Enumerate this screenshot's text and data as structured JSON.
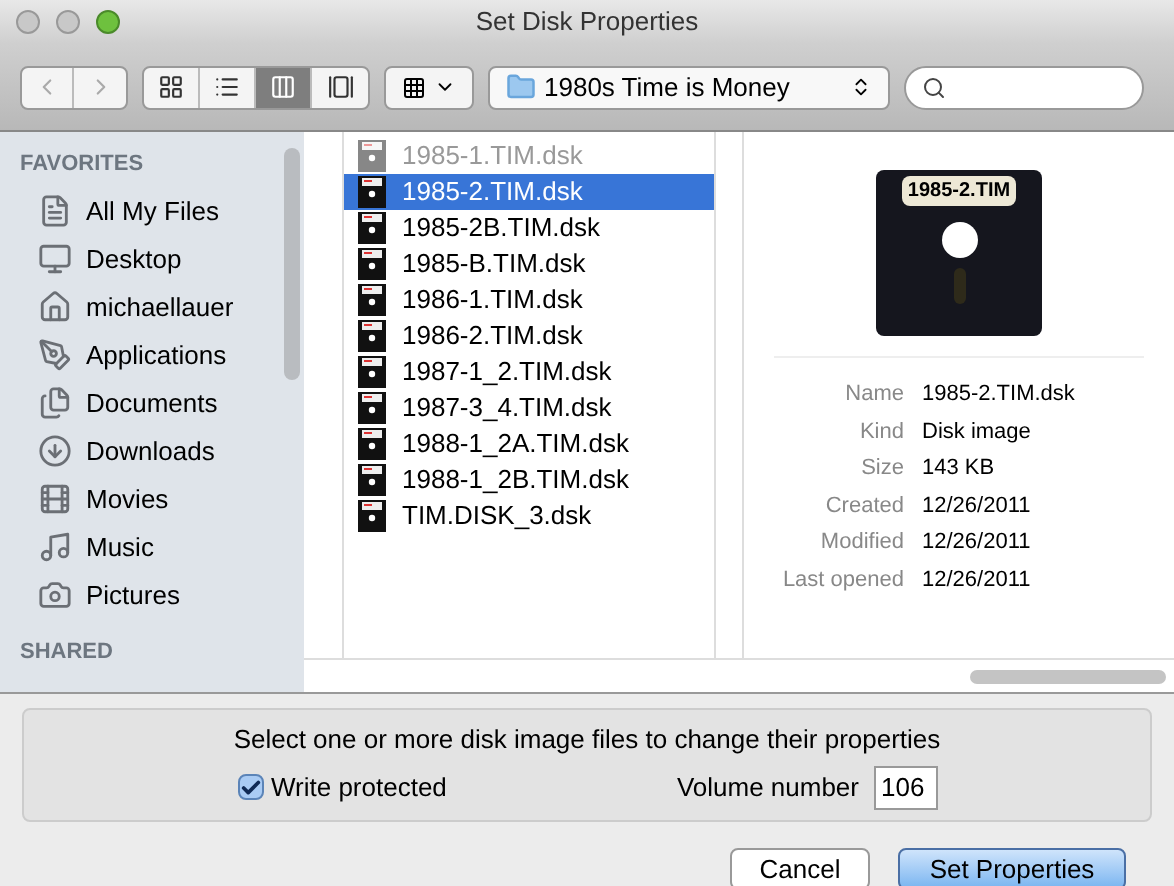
{
  "window": {
    "title": "Set Disk Properties"
  },
  "toolbar": {
    "view_modes": [
      {
        "kind": "icons",
        "selected": false
      },
      {
        "kind": "list",
        "selected": false
      },
      {
        "kind": "columns",
        "selected": true
      },
      {
        "kind": "coverflow",
        "selected": false
      }
    ],
    "location": "1980s Time is Money"
  },
  "sidebar": {
    "sections": [
      {
        "heading": "FAVORITES",
        "items": [
          {
            "label": "All My Files",
            "kind": "files"
          },
          {
            "label": "Desktop",
            "kind": "desktop"
          },
          {
            "label": "michaellauer",
            "kind": "home"
          },
          {
            "label": "Applications",
            "kind": "apps"
          },
          {
            "label": "Documents",
            "kind": "documents"
          },
          {
            "label": "Downloads",
            "kind": "downloads"
          },
          {
            "label": "Movies",
            "kind": "movies"
          },
          {
            "label": "Music",
            "kind": "music"
          },
          {
            "label": "Pictures",
            "kind": "pictures"
          }
        ]
      },
      {
        "heading": "SHARED"
      }
    ]
  },
  "files": [
    {
      "name": "1985-1.TIM.dsk",
      "selected": false,
      "dimmed": true
    },
    {
      "name": "1985-2.TIM.dsk",
      "selected": true,
      "dimmed": false
    },
    {
      "name": "1985-2B.TIM.dsk",
      "selected": false,
      "dimmed": false
    },
    {
      "name": "1985-B.TIM.dsk",
      "selected": false,
      "dimmed": false
    },
    {
      "name": "1986-1.TIM.dsk",
      "selected": false,
      "dimmed": false
    },
    {
      "name": "1986-2.TIM.dsk",
      "selected": false,
      "dimmed": false
    },
    {
      "name": "1987-1_2.TIM.dsk",
      "selected": false,
      "dimmed": false
    },
    {
      "name": "1987-3_4.TIM.dsk",
      "selected": false,
      "dimmed": false
    },
    {
      "name": "1988-1_2A.TIM.dsk",
      "selected": false,
      "dimmed": false
    },
    {
      "name": "1988-1_2B.TIM.dsk",
      "selected": false,
      "dimmed": false
    },
    {
      "name": "TIM.DISK_3.dsk",
      "selected": false,
      "dimmed": false
    }
  ],
  "preview": {
    "disk_label": "1985-2.TIM",
    "info": [
      {
        "label": "Name",
        "value": "1985-2.TIM.dsk"
      },
      {
        "label": "Kind",
        "value": "Disk image"
      },
      {
        "label": "Size",
        "value": "143 KB"
      },
      {
        "label": "Created",
        "value": "12/26/2011"
      },
      {
        "label": "Modified",
        "value": "12/26/2011"
      },
      {
        "label": "Last opened",
        "value": "12/26/2011"
      }
    ]
  },
  "options": {
    "instructions": "Select one or more disk image files to change their properties",
    "write_protected": {
      "label": "Write protected",
      "checked": true
    },
    "volume": {
      "label": "Volume number",
      "value": "106"
    }
  },
  "buttons": [
    {
      "label": "Cancel",
      "kind": "cancel"
    },
    {
      "label": "Set Properties",
      "kind": "default"
    }
  ]
}
